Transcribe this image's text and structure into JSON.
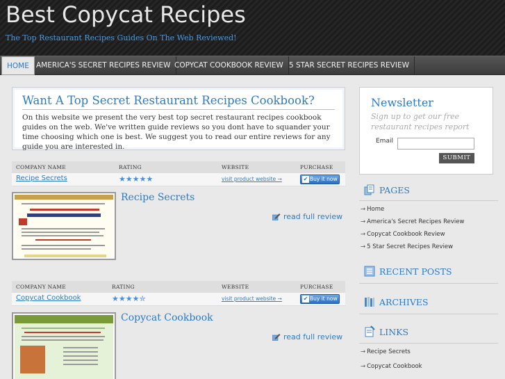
{
  "site": {
    "title": "Best Copycat Recipes",
    "tagline": "The Top Restaurant Recipes Guides On The Web Reviewed!"
  },
  "nav": {
    "items": [
      {
        "label": "HOME",
        "active": true
      },
      {
        "label": "AMERICA'S SECRET RECIPES REVIEW",
        "active": false
      },
      {
        "label": "COPYCAT COOKBOOK REVIEW",
        "active": false
      },
      {
        "label": "5 STAR SECRET RECIPES REVIEW",
        "active": false
      }
    ]
  },
  "intro": {
    "title": "Want A Top Secret Restaurant Recipes Cookbook?",
    "text": "On this website we present the very best top secret restaurant recipes cookbook guides on the web. We've written guide reviews so you dont have to squander your time choosing which one is best. We suggest you to read our entire reviews for any guide you are interested in."
  },
  "table_headers": {
    "company": "COMPANY NAME",
    "rating": "RATING",
    "website": "WEBSITE",
    "purchase": "PURCHASE"
  },
  "products": [
    {
      "name": "Recipe Secrets",
      "rating": 5,
      "stars": "★★★★★",
      "website_link": "visit product website →",
      "buy_label": "Buy it now",
      "title": "Recipe Secrets",
      "read_more": "read full review"
    },
    {
      "name": "Copycat Cookbook",
      "rating": 4.5,
      "stars": "★★★★✮",
      "website_link": "visit product website →",
      "buy_label": "Buy it now",
      "title": "Copycat Cookbook",
      "read_more": "read full review"
    }
  ],
  "newsletter": {
    "title": "Newsletter",
    "subtitle": "Sign up to get our free restaurant recipes report",
    "email_label": "Email",
    "email_value": "",
    "submit_label": "SUBMIT"
  },
  "sidebar": {
    "pages_title": "PAGES",
    "pages": [
      "Home",
      "America's Secret Recipes Review",
      "Copycat Cookbook Review",
      "5 Star Secret Recipes Review"
    ],
    "recent_title": "RECENT POSTS",
    "archives_title": "ARCHIVES",
    "links_title": "LINKS",
    "links": [
      "Recipe Secrets",
      "Copycat Cookbook"
    ],
    "arrow": "→"
  },
  "colors": {
    "accent": "#2b7bc4",
    "header_bg": "#1c1c1c",
    "nav_bg": "#4a4a4a",
    "page_bg": "#e9e9e9"
  }
}
